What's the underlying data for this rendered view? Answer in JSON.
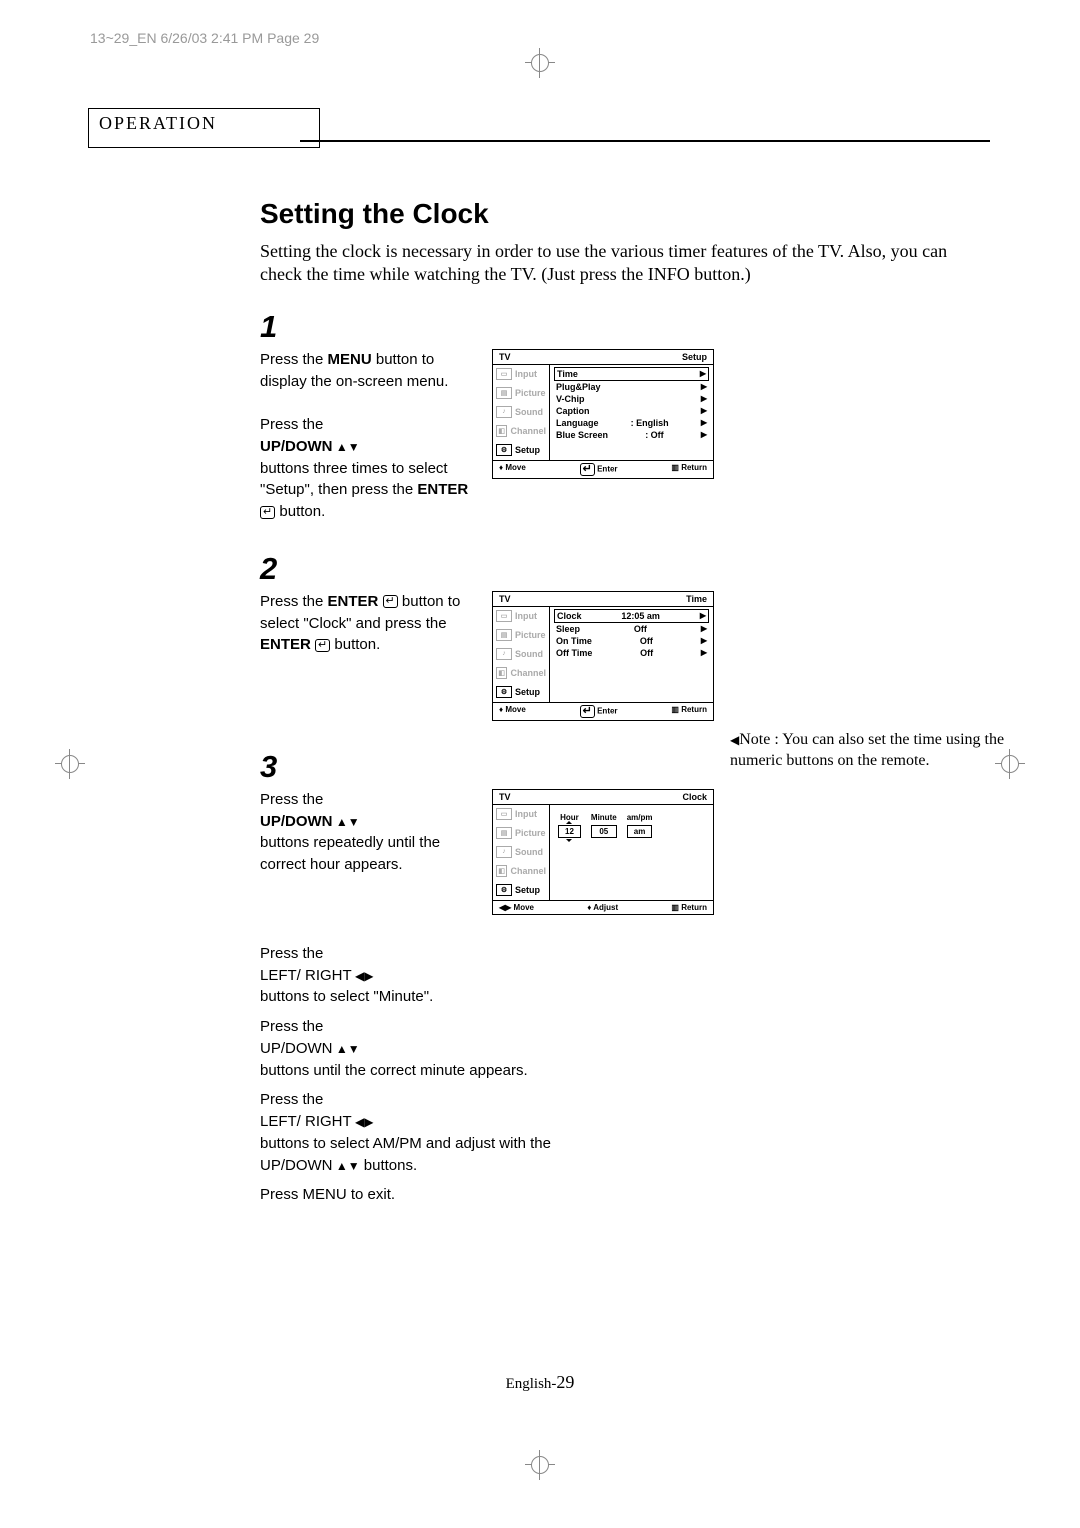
{
  "header_line": "13~29_EN  6/26/03  2:41 PM  Page 29",
  "section": "OPERATION",
  "title": "Setting the Clock",
  "intro": "Setting the clock is  necessary in order to use the various timer features of the TV. Also, you can check the time while watching the TV. (Just press the INFO button.)",
  "steps": {
    "s1": {
      "num": "1",
      "p1a": "Press the ",
      "p1b": "MENU",
      "p1c": " button to display the on-screen menu.",
      "p2a": "Press the ",
      "p2b": "UP/DOWN",
      "p2c": " buttons three times to select \"Setup\", then press the ",
      "p2d": "ENTER",
      "p2e": " button."
    },
    "s2": {
      "num": "2",
      "p1a": "Press the ",
      "p1b": "ENTER",
      "p1c": " button to select \"Clock\" and press the ",
      "p1d": "ENTER",
      "p1e": " button."
    },
    "s3": {
      "num": "3",
      "p1a": "Press the ",
      "p1b": "UP/DOWN",
      "p1c": " buttons repeatedly until the correct hour appears.",
      "p2a": "Press the ",
      "p2b": "LEFT/ RIGHT",
      "p2c": " buttons to select \"Minute\".",
      "p3a": "Press the ",
      "p3b": "UP/DOWN",
      "p3c": " buttons until the correct minute appears.",
      "p4a": "Press the ",
      "p4b": "LEFT/ RIGHT",
      "p4c": " buttons to select AM/PM and adjust with the ",
      "p4d": "UP/DOWN",
      "p4e": " buttons.",
      "p5a": "Press ",
      "p5b": "MENU",
      "p5c": " to exit."
    }
  },
  "osd_side": {
    "i0": "Input",
    "i1": "Picture",
    "i2": "Sound",
    "i3": "Channel",
    "i4": "Setup"
  },
  "osd1": {
    "tv": "TV",
    "title": "Setup",
    "rows": {
      "r0": {
        "l": "Time",
        "v": "",
        "a": "▶"
      },
      "r1": {
        "l": "Plug&Play",
        "v": "",
        "a": "▶"
      },
      "r2": {
        "l": "V-Chip",
        "v": "",
        "a": "▶"
      },
      "r3": {
        "l": "Caption",
        "v": "",
        "a": "▶"
      },
      "r4": {
        "l": "Language",
        "v": ": English",
        "a": "▶"
      },
      "r5": {
        "l": "Blue Screen",
        "v": ": Off",
        "a": "▶"
      }
    },
    "foot": {
      "move": "Move",
      "enter": "Enter",
      "ret": "Return"
    }
  },
  "osd2": {
    "tv": "TV",
    "title": "Time",
    "rows": {
      "r0": {
        "l": "Clock",
        "v": "12:05 am",
        "a": "▶"
      },
      "r1": {
        "l": "Sleep",
        "v": "Off",
        "a": "▶"
      },
      "r2": {
        "l": "On Time",
        "v": "Off",
        "a": "▶"
      },
      "r3": {
        "l": "Off Time",
        "v": "Off",
        "a": "▶"
      }
    },
    "foot": {
      "move": "Move",
      "enter": "Enter",
      "ret": "Return"
    }
  },
  "osd3": {
    "tv": "TV",
    "title": "Clock",
    "cols": {
      "c0": "Hour",
      "c1": "Minute",
      "c2": "am/pm"
    },
    "vals": {
      "v0": "12",
      "v1": "05",
      "v2": "am"
    },
    "foot": {
      "move": "Move",
      "adjust": "Adjust",
      "ret": "Return"
    }
  },
  "sidenote": "Note : You can also set the time using the numeric buttons on the remote.",
  "footer": {
    "lang": "English-",
    "num": "29"
  }
}
